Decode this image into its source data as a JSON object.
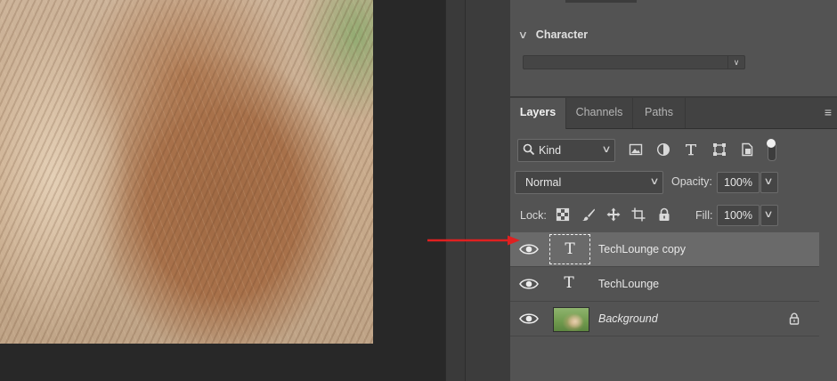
{
  "character": {
    "title": "Character"
  },
  "layers_panel": {
    "tabs": [
      {
        "label": "Layers",
        "active": true
      },
      {
        "label": "Channels",
        "active": false
      },
      {
        "label": "Paths",
        "active": false
      }
    ],
    "filter": {
      "kind_label": "Kind",
      "toggle_on": true
    },
    "blend": {
      "mode": "Normal",
      "opacity_label": "Opacity:",
      "opacity": "100%"
    },
    "lock": {
      "label": "Lock:",
      "fill_label": "Fill:",
      "fill": "100%"
    },
    "layers": [
      {
        "name": "TechLounge copy",
        "type": "text",
        "selected": true,
        "visible": true,
        "locked": false
      },
      {
        "name": "TechLounge",
        "type": "text",
        "selected": false,
        "visible": true,
        "locked": false
      },
      {
        "name": "Background",
        "type": "image",
        "selected": false,
        "visible": true,
        "locked": true
      }
    ],
    "thumbnail_text_glyph": "T"
  },
  "annotation": {
    "arrow_color": "#e02020"
  },
  "colors": {
    "panel": "#535353",
    "canvas_bg": "#282828",
    "selected_row": "#6a6a6a"
  }
}
